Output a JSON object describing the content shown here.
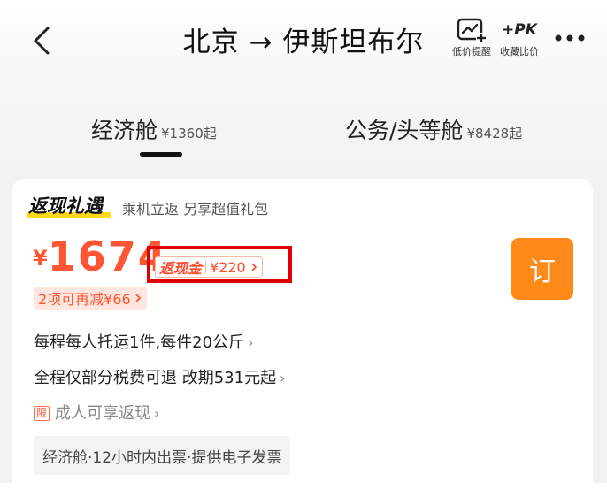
{
  "header": {
    "title": "北京 → 伊斯坦布尔",
    "price_alert_label": "低价提醒",
    "pk_icon_text": "+PK",
    "compare_label": "收藏比价"
  },
  "tabs": [
    {
      "label": "经济舱",
      "price": "¥1360起",
      "active": true
    },
    {
      "label": "公务/头等舱",
      "price": "¥8428起",
      "active": false
    }
  ],
  "card": {
    "promo_title": "返现礼遇",
    "promo_subtitle": "乘机立返 另享超值礼包",
    "price_symbol": "¥",
    "price_value": "1674",
    "cashback_label": "返现金",
    "cashback_amount": "¥220",
    "reduce_text": "2项可再减¥66",
    "book_label": "订",
    "baggage_text": "每程每人托运1件,每件20公斤",
    "refund_text": "全程仅部分税费可退 改期531元起",
    "limit_badge": "限",
    "adult_cashback_text": "成人可享返现",
    "tag_text": "经济舱·12小时内出票·提供电子发票"
  },
  "colors": {
    "accent": "#ff5533",
    "book_button": "#ff8a1a",
    "highlight_box": "#e00000"
  },
  "icons": [
    "back-arrow-icon",
    "price-alert-icon",
    "pk-icon",
    "more-icon",
    "chevron-right-icon"
  ]
}
